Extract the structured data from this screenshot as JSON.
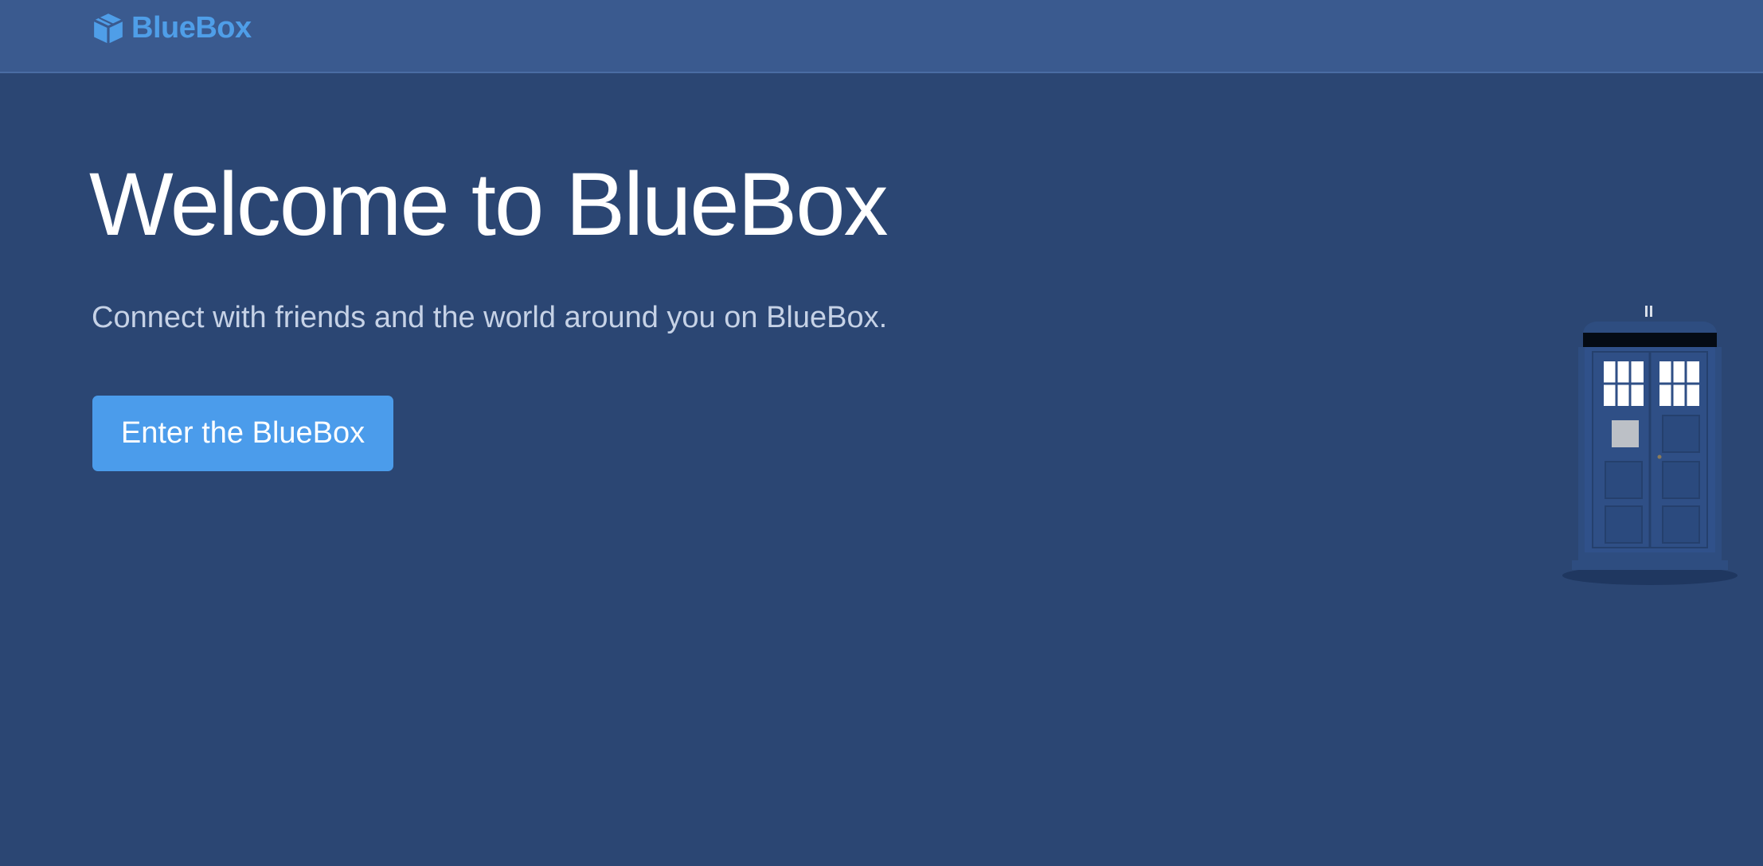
{
  "navbar": {
    "brand_name": "BlueBox",
    "brand_icon": "cube-icon"
  },
  "hero": {
    "title": "Welcome to BlueBox",
    "subtitle": "Connect with friends and the world around you on BlueBox.",
    "cta_label": "Enter the BlueBox",
    "illustration": "police-box-illustration"
  },
  "colors": {
    "background": "#2b4673",
    "navbar": "#3a5a8f",
    "accent": "#4b9ceb",
    "title_text": "#ffffff",
    "subtitle_text": "#c6d2e6"
  }
}
